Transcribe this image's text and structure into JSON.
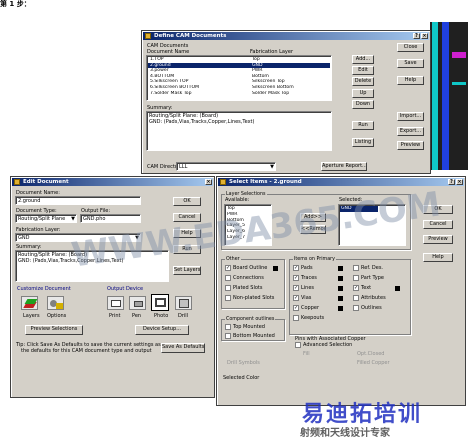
{
  "page": {
    "step_label": "第 1 步：",
    "wm_site": "WWW.EDA365.COM",
    "wm_big": "易迪拓培训",
    "wm_sub": "射频和天线设计专家",
    "accent": "#0a246a",
    "pcb_colors": [
      "#10c8c8",
      "#2040e0",
      "#d020d0",
      "#202020"
    ]
  },
  "define": {
    "title": "Define CAM Documents",
    "cam_documents": "CAM Documents",
    "col_name": "Document Name",
    "col_layer": "Fabrication Layer",
    "rows": [
      {
        "name": "1.TOP",
        "layer": "Top"
      },
      {
        "name": "2.ground",
        "layer": "GND"
      },
      {
        "name": "3.power",
        "layer": "PWR"
      },
      {
        "name": "4.BOTTOM",
        "layer": "Bottom"
      },
      {
        "name": "5.Silkscreen TOP",
        "layer": "Silkscreen Top"
      },
      {
        "name": "6.Silkscreen BOTTOM",
        "layer": "Silkscreen Bottom"
      },
      {
        "name": "7.Solder Mask Top",
        "layer": "Solder Mask Top"
      }
    ],
    "summary_label": "Summary:",
    "summary": [
      "Routing/Split Plane: (Board)",
      "GND: (Pads,Vias,Tracks,Copper,Lines,Text)"
    ],
    "cam_dir_label": "CAM Directory:",
    "cam_dir": "LLL",
    "aperture": "Aperture Report...",
    "buttons": {
      "close": "Close",
      "save": "Save",
      "help": "Help",
      "add": "Add...",
      "edit": "Edit",
      "delete": "Delete",
      "up": "Up",
      "down": "Down",
      "run": "Run",
      "listing": "Listing",
      "import": "Import...",
      "export": "Export...",
      "preview": "Preview"
    }
  },
  "edit": {
    "title": "Edit Document",
    "doc_name_label": "Document Name:",
    "doc_name": "2.ground",
    "doc_type_label": "Document Type:",
    "doc_type": "Routing/Split Plane",
    "output_label": "Output File:",
    "output_file": "GND.pho",
    "fab_label": "Fabrication Layer:",
    "fab_layer": "GND",
    "summary_label": "Summary:",
    "summary": [
      "Routing/Split Plane: (Board)",
      "GND: (Pads,Vias,Tracks,Copper,Lines,Text)"
    ],
    "set_layers": "Set Layers...",
    "customize": "Customize Document",
    "output_device": "Output Device",
    "icons": [
      "Layers",
      "Options",
      "Print",
      "Pen",
      "Photo",
      "Drill"
    ],
    "preview_sel": "Preview Selections",
    "device_setup": "Device Setup...",
    "tip": [
      "Tip: Click Save As Defaults to save the current settings as",
      "the defaults for this CAM document type and output"
    ],
    "save_defaults": "Save As Defaults",
    "buttons": {
      "ok": "OK",
      "cancel": "Cancel",
      "help": "Help",
      "run": "Run"
    }
  },
  "select": {
    "title": "Select Items - 2.ground",
    "layer_sel": "Layer Selections",
    "available": "Available:",
    "selected": "Selected:",
    "available_items": [
      "Top",
      "PWR",
      "Bottom",
      "Layer_5",
      "Layer_6",
      "Layer_7"
    ],
    "selected_items": [
      "GND"
    ],
    "add": "Add>>",
    "remove": "<<Remove",
    "other": "Other",
    "other_items": [
      {
        "label": "Board Outline",
        "checked": true,
        "swatch": true
      },
      {
        "label": "Connections",
        "checked": false
      },
      {
        "label": "Plated Slots",
        "checked": false
      },
      {
        "label": "Non-plated Slots",
        "checked": false
      }
    ],
    "primary": "Items on Primary",
    "primary_left": [
      {
        "label": "Pads",
        "checked": true
      },
      {
        "label": "Traces",
        "checked": true
      },
      {
        "label": "Lines",
        "checked": true
      },
      {
        "label": "Vias",
        "checked": true
      },
      {
        "label": "Copper",
        "checked": true
      },
      {
        "label": "Keepouts",
        "checked": false
      }
    ],
    "primary_right": [
      {
        "label": "Ref. Des.",
        "checked": false
      },
      {
        "label": "Part Type",
        "checked": false
      },
      {
        "label": "Text",
        "checked": true
      },
      {
        "label": "Attributes",
        "checked": false
      },
      {
        "label": "Outlines",
        "checked": false
      }
    ],
    "component": "Component outlines",
    "comp_items": [
      "Top Mounted",
      "Bottom Mounted"
    ],
    "assoc": "Pins with Associated Copper",
    "advanced": "Advanced Selection",
    "dim1": "Fill",
    "dim2": "Opt.Closed",
    "dim3": "Filled Copper",
    "dim4": "Drill Symbols",
    "sel_color": "Selected Color",
    "buttons": {
      "ok": "OK",
      "cancel": "Cancel",
      "preview": "Preview",
      "help": "Help"
    }
  }
}
